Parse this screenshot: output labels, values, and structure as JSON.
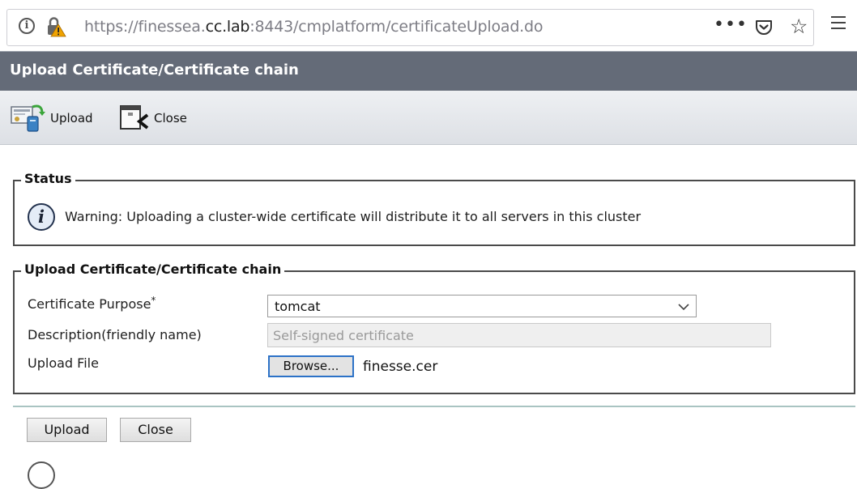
{
  "browser": {
    "url_prefix": "https://finessea.",
    "url_host": "cc.lab",
    "url_suffix": ":8443/cmplatform/certificateUpload.do",
    "more_label": "•••",
    "star_glyph": "☆",
    "info_glyph": "i"
  },
  "page": {
    "title": "Upload Certificate/Certificate chain"
  },
  "toolbar": {
    "upload_label": "Upload",
    "close_label": "Close"
  },
  "status": {
    "legend": "Status",
    "icon_glyph": "i",
    "message": "Warning: Uploading a cluster-wide certificate will distribute it to all servers in this cluster"
  },
  "upload_form": {
    "legend": "Upload Certificate/Certificate chain",
    "purpose_label": "Certificate Purpose",
    "required_marker": "*",
    "purpose_value": "tomcat",
    "description_label": "Description(friendly name)",
    "description_value": "Self-signed certificate",
    "file_label": "Upload File",
    "browse_label": "Browse...",
    "file_name": "finesse.cer"
  },
  "actions": {
    "upload_label": "Upload",
    "close_label": "Close"
  },
  "colors": {
    "title_bar": "#646b78",
    "browse_focus": "#2c72c7",
    "divider": "#a9c4c2"
  },
  "icons": {
    "info": "info-circle-icon",
    "lock_warning": "lock-warning-icon",
    "pocket": "pocket-icon",
    "star": "star-icon",
    "menu": "hamburger-menu-icon",
    "upload": "upload-certificate-icon",
    "close": "close-window-icon"
  }
}
